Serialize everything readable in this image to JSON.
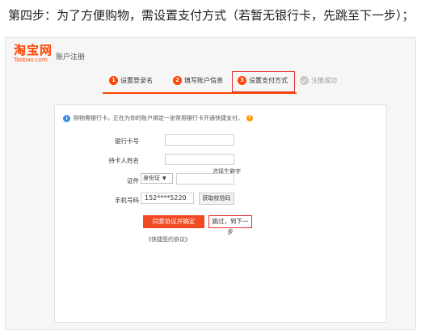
{
  "caption": "第四步：为了方便购物，需设置支付方式（若暂无银行卡，先跳至下一步）；",
  "header": {
    "logo_main": "淘宝网",
    "logo_sub": "Taobao.com",
    "title": "账户注册"
  },
  "steps": [
    {
      "num": "1",
      "label": "设置登录名"
    },
    {
      "num": "2",
      "label": "填写账户信息"
    },
    {
      "num": "3",
      "label": "设置支付方式"
    },
    {
      "num": "",
      "label": "注册成功"
    }
  ],
  "form": {
    "notice": "购物需银行卡，正在为你的账户绑定一张常用银行卡开通快捷支付。",
    "bank_card_label": "银行卡号",
    "holder_label": "持卡人姓名",
    "id_label": "证件",
    "id_type": "身份证",
    "id_hint": "选择生僻字",
    "phone_label": "手机号码",
    "phone_value": "152****5220",
    "get_code_button": "获取校验码",
    "agree_button": "同意协议并确定",
    "skip_button": "跳过，到下一步",
    "agreement_link": "《快捷签约协议》"
  },
  "colors": {
    "brand": "#ff4400",
    "primary_button": "#f04a22",
    "highlight_box": "#e03030",
    "info": "#3a8ee6"
  }
}
